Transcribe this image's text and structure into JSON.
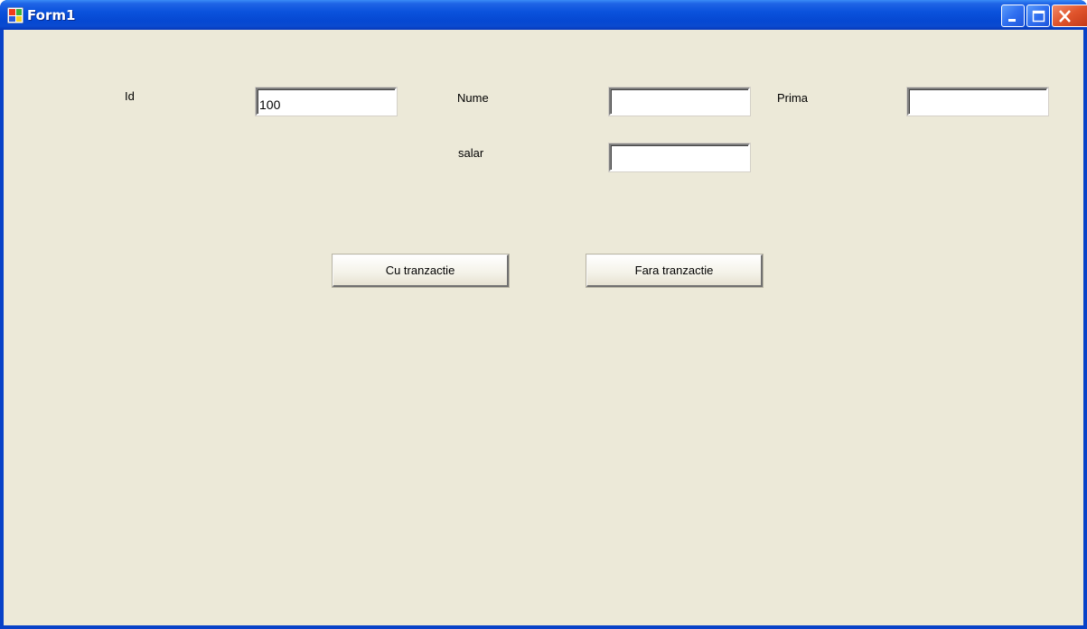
{
  "window": {
    "title": "Form1",
    "icon": "windows-form-icon",
    "controls": [
      "minimize-icon",
      "maximize-icon",
      "close-icon"
    ]
  },
  "form": {
    "id_label": "Id",
    "id_value": "100",
    "nume_label": "Nume",
    "nume_value": "",
    "prima_label": "Prima",
    "prima_value": "",
    "salar_label": "salar",
    "salar_value": "",
    "btn_cu_tranzactie": "Cu tranzactie",
    "btn_fara_tranzactie": "Fara tranzactie"
  },
  "colors": {
    "titlebar": "#0a52dc",
    "client_background": "#ece9d8",
    "close_button": "#e0542c"
  }
}
